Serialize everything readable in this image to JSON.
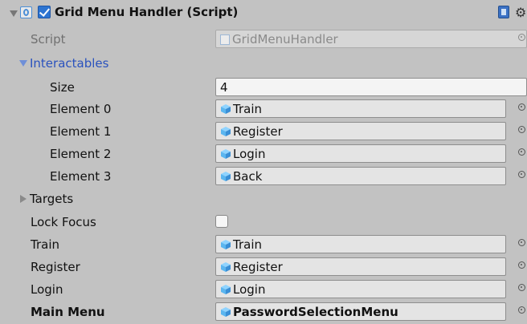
{
  "header": {
    "title": "Grid Menu Handler (Script)"
  },
  "script_row": {
    "label": "Script",
    "value": "GridMenuHandler"
  },
  "interactables": {
    "label": "Interactables",
    "size_label": "Size",
    "size_value": "4",
    "elements": [
      {
        "label": "Element 0",
        "value": "Train"
      },
      {
        "label": "Element 1",
        "value": "Register"
      },
      {
        "label": "Element 2",
        "value": "Login"
      },
      {
        "label": "Element 3",
        "value": "Back"
      }
    ]
  },
  "targets": {
    "label": "Targets"
  },
  "lock_focus": {
    "label": "Lock Focus",
    "checked": false
  },
  "fields": [
    {
      "label": "Train",
      "value": "Train"
    },
    {
      "label": "Register",
      "value": "Register"
    },
    {
      "label": "Login",
      "value": "Login"
    },
    {
      "label": "Main Menu",
      "value": "PasswordSelectionMenu"
    }
  ],
  "icons": {
    "script": "script-icon",
    "help": "help-book-icon",
    "settings": "gear-icon",
    "gameobject": "gameobject-cube-icon",
    "picker": "object-picker-icon"
  },
  "colors": {
    "background": "#c2c2c2",
    "foldout_blue": "#2a52be",
    "checkbox_blue": "#2d74d1",
    "cube_light": "#8fd3ff",
    "cube_dark": "#3a8fd6"
  }
}
